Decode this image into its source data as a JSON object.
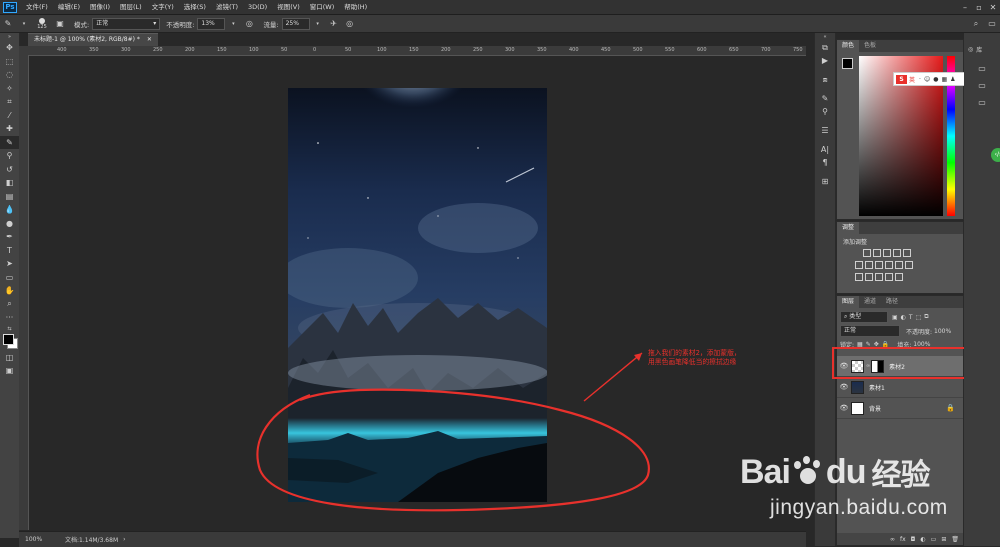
{
  "app": {
    "logo": "Ps"
  },
  "menu": [
    "文件(F)",
    "编辑(E)",
    "图像(I)",
    "图层(L)",
    "文字(Y)",
    "选择(S)",
    "滤镜(T)",
    "3D(D)",
    "视图(V)",
    "窗口(W)",
    "帮助(H)"
  ],
  "options": {
    "brush_size": "125",
    "mode_label": "模式:",
    "mode_value": "正常",
    "opacity_label": "不透明度:",
    "opacity_value": "13%",
    "flow_label": "流量:",
    "flow_value": "25%"
  },
  "document": {
    "tab_title": "未标题-1 @ 100% (素材2, RGB/8#) *",
    "status_zoom": "100%",
    "status_doc": "文档:1.14M/3.68M"
  },
  "ruler_ticks": [
    "400",
    "350",
    "300",
    "250",
    "200",
    "150",
    "100",
    "50",
    "0",
    "50",
    "100",
    "150",
    "200",
    "250",
    "300",
    "350",
    "400",
    "450",
    "500",
    "550",
    "600",
    "650",
    "700",
    "750"
  ],
  "panels": {
    "color_tabs": [
      "颜色",
      "色板"
    ],
    "adjust_tab": "调整",
    "adjust_add_label": "添加调整",
    "layers_tabs": [
      "图层",
      "通道",
      "路径"
    ],
    "layer_filter": "类型",
    "blend_mode": "正常",
    "opacity_label": "不透明度:",
    "opacity_value": "100%",
    "lock_label": "锁定:",
    "fill_label": "填充:",
    "fill_value": "100%",
    "lib_label": "库"
  },
  "layers": [
    {
      "name": "素材2",
      "selected": true
    },
    {
      "name": "素材1",
      "selected": false
    },
    {
      "name": "背景",
      "selected": false
    }
  ],
  "ime": {
    "label": "英"
  },
  "annotation": {
    "line1": "拖入我们的素材2，添加蒙版，",
    "line2": "用黑色画笔降低当的擦拭边缘",
    "color": "#e8312c"
  },
  "watermark": {
    "brand_left": "Bai",
    "brand_right": "du",
    "brand_cn": "经验",
    "url": "jingyan.baidu.com"
  },
  "colors": {
    "accent": "#31a8ff",
    "annotation_red": "#e8312c"
  }
}
